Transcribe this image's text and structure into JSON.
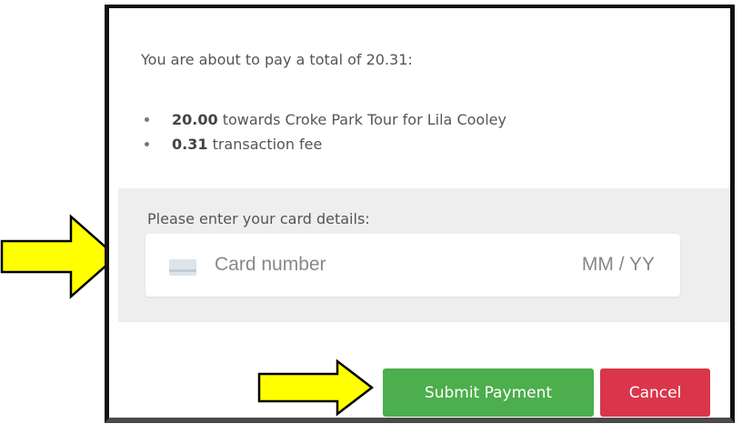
{
  "payment": {
    "summary": "You are about to pay a total of 20.31:",
    "items": [
      {
        "amount": "20.00",
        "description": "towards Croke Park Tour for Lila Cooley"
      },
      {
        "amount": "0.31",
        "description": "transaction fee"
      }
    ]
  },
  "card": {
    "label": "Please enter your card details:",
    "number_placeholder": "Card number",
    "expiry_placeholder": "MM / YY",
    "icon": "credit-card-icon"
  },
  "actions": {
    "submit_label": "Submit Payment",
    "cancel_label": "Cancel"
  },
  "colors": {
    "submit": "#4cae4c",
    "cancel": "#d9364b",
    "arrow_fill": "#ffff00",
    "arrow_stroke": "#000000",
    "panel": "#eeeeee"
  },
  "annotations": {
    "icon": "arrow-right-icon"
  }
}
